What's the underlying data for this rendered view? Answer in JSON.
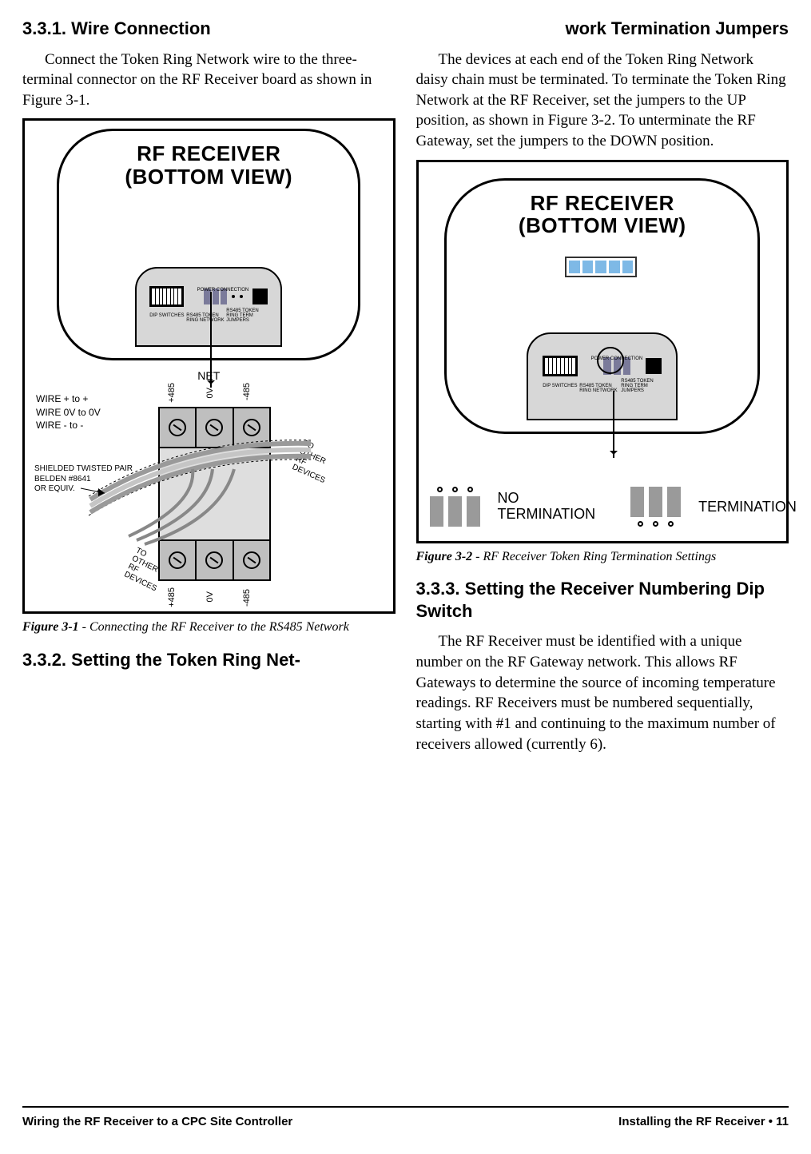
{
  "left": {
    "h_331": "3.3.1.  Wire Connection",
    "p_331": "Connect the Token Ring Network wire to the three-terminal connector on the RF Receiver board as shown in Figure 3-1.",
    "fig1": {
      "device_title_l1": "RF RECEIVER",
      "device_title_l2": "(BOTTOM VIEW)",
      "panel_labels": {
        "dip": "DIP SWITCHES",
        "rs485_l1": "RS485 TOKEN",
        "rs485_l2": "RING NETWORK",
        "term_l1": "RS485 TOKEN",
        "term_l2": "RING TERM",
        "term_l3": "JUMPERS",
        "power": "POWER CONNECTION"
      },
      "net": "NET",
      "wire_plus": "WIRE + to +",
      "wire_0v": "WIRE 0V to 0V",
      "wire_minus": "WIRE - to -",
      "shielded_l1": "SHIELDED TWISTED PAIR",
      "shielded_l2": "BELDEN #8641",
      "shielded_l3": "OR EQUIV.",
      "to_other_l1": "TO",
      "to_other_l2": "OTHER",
      "to_other_l3": "RF",
      "to_other_l4": "DEVICES",
      "axis_plus485": "+485",
      "axis_0v": "0V",
      "axis_minus485": "-485"
    },
    "caption1_num": "Figure 3-1",
    "caption1_txt": " - Connecting the RF Receiver to the RS485 Network",
    "h_332": "3.3.2.  Setting the Token Ring Net-"
  },
  "right": {
    "h_332b": "work Termination Jumpers",
    "p_332": "The devices at each end of the Token Ring Network daisy chain must be terminated. To terminate the Token Ring Network at the RF Receiver, set the jumpers to the UP position, as shown in Figure 3-2. To unterminate the RF Gateway, set the jumpers to the DOWN position.",
    "fig2": {
      "device_title_l1": "RF RECEIVER",
      "device_title_l2": "(BOTTOM VIEW)",
      "panel_labels": {
        "dip": "DIP SWITCHES",
        "rs485_l1": "RS485 TOKEN",
        "rs485_l2": "RING NETWORK",
        "term_l1": "RS485 TOKEN",
        "term_l2": "RING TERM",
        "term_l3": "JUMPERS",
        "power": "POWER CONNECTION"
      },
      "no_term_l1": "NO",
      "no_term_l2": "TERMINATION",
      "term": "TERMINATION"
    },
    "caption2_num": "Figure 3-2",
    "caption2_txt": " - RF Receiver Token Ring Termination Settings",
    "h_333": "3.3.3.  Setting the Receiver Numbering Dip Switch",
    "p_333": "The RF Receiver must be identified with a unique number on the RF Gateway network. This allows RF Gateways to determine the source of incoming temperature readings. RF Receivers must be numbered sequentially, starting with #1 and continuing to the maximum number of receivers allowed (currently 6)."
  },
  "footer": {
    "left": "Wiring the RF Receiver to a CPC Site Controller",
    "right": "Installing the RF Receiver • 11"
  }
}
